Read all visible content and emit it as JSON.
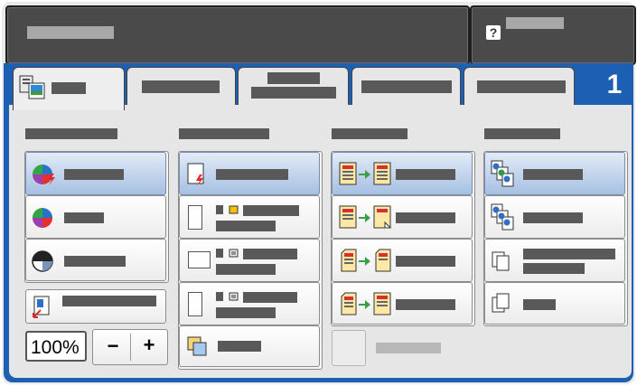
{
  "tab_count": "1",
  "zoom": {
    "value": "100%",
    "decrease": "−",
    "increase": "+"
  },
  "colors": {
    "accent": "#1d5fb2",
    "selected": "#a6bfe2"
  },
  "icons": {
    "help": "help-icon",
    "color_auto": "color-auto-icon",
    "full_color": "full-color-icon",
    "black_white": "black-and-white-icon",
    "reduce_enlarge": "reduce-enlarge-icon",
    "paper_auto": "paper-auto-icon",
    "sided_1to1": "one-to-one-sided-icon",
    "sided_1to2": "one-to-two-sided-icon",
    "sided_2to2": "two-to-two-sided-icon",
    "sided_2to1": "two-to-one-sided-icon",
    "collated": "collated-icon",
    "uncollated": "uncollated-icon",
    "uncollated_tray": "uncollated-tray-icon",
    "stack": "stacked-icon"
  }
}
